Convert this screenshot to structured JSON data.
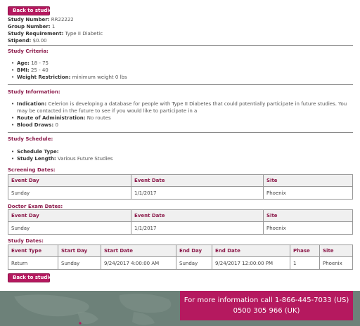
{
  "back_button_label": "Back to studies",
  "summary": {
    "study_number": {
      "label": "Study Number:",
      "value": "RR22222"
    },
    "group_number": {
      "label": "Group Number:",
      "value": "1"
    },
    "study_requirement": {
      "label": "Study Requirement:",
      "value": "Type II Diabetic"
    },
    "stipend": {
      "label": "Stipend:",
      "value": "$0.00"
    }
  },
  "criteria": {
    "title": "Study Criteria:",
    "age": {
      "label": "Age:",
      "value": "18 - 75"
    },
    "bmi": {
      "label": "BMI:",
      "value": "25 - 40"
    },
    "weight": {
      "label": "Weight Restriction:",
      "value": "minimum weight 0 lbs"
    }
  },
  "information": {
    "title": "Study Information:",
    "indication": {
      "label": "Indication:",
      "value": "Celerion is developing a database for people with Type II Diabetes that could potentially participate in future studies. You may be contacted in the future to see if you would like to participate in a"
    },
    "route": {
      "label": "Route of Administration:",
      "value": "No routes"
    },
    "blood": {
      "label": "Blood Draws:",
      "value": "0"
    }
  },
  "schedule": {
    "title": "Study Schedule:",
    "type": {
      "label": "Schedule Type:",
      "value": ""
    },
    "length": {
      "label": "Study Length:",
      "value": "Various Future Studies"
    }
  },
  "screening": {
    "title": "Screening Dates:",
    "headers": [
      "Event Day",
      "Event Date",
      "Site"
    ],
    "rows": [
      [
        "Sunday",
        "1/1/2017",
        "Phoenix"
      ]
    ]
  },
  "doctor_exam": {
    "title": "Doctor Exam Dates:",
    "headers": [
      "Event Day",
      "Event Date",
      "Site"
    ],
    "rows": [
      [
        "Sunday",
        "1/1/2017",
        "Phoenix"
      ]
    ]
  },
  "study_dates": {
    "title": "Study Dates:",
    "headers": [
      "Event Type",
      "Start Day",
      "Start Date",
      "End Day",
      "End Date",
      "Phase",
      "Site"
    ],
    "rows": [
      [
        "Return",
        "Sunday",
        "9/24/2017 4:00:00 AM",
        "Sunday",
        "9/24/2017 12:00:00 PM",
        "1",
        "Phoenix"
      ]
    ]
  },
  "footer": {
    "line1": "For more information call 1-866-445-7033 (US)",
    "line2": "0500 305 966 (UK)"
  },
  "colors": {
    "accent": "#b5195f",
    "heading": "#8b1a4a",
    "footer_bg": "#6d8179"
  }
}
